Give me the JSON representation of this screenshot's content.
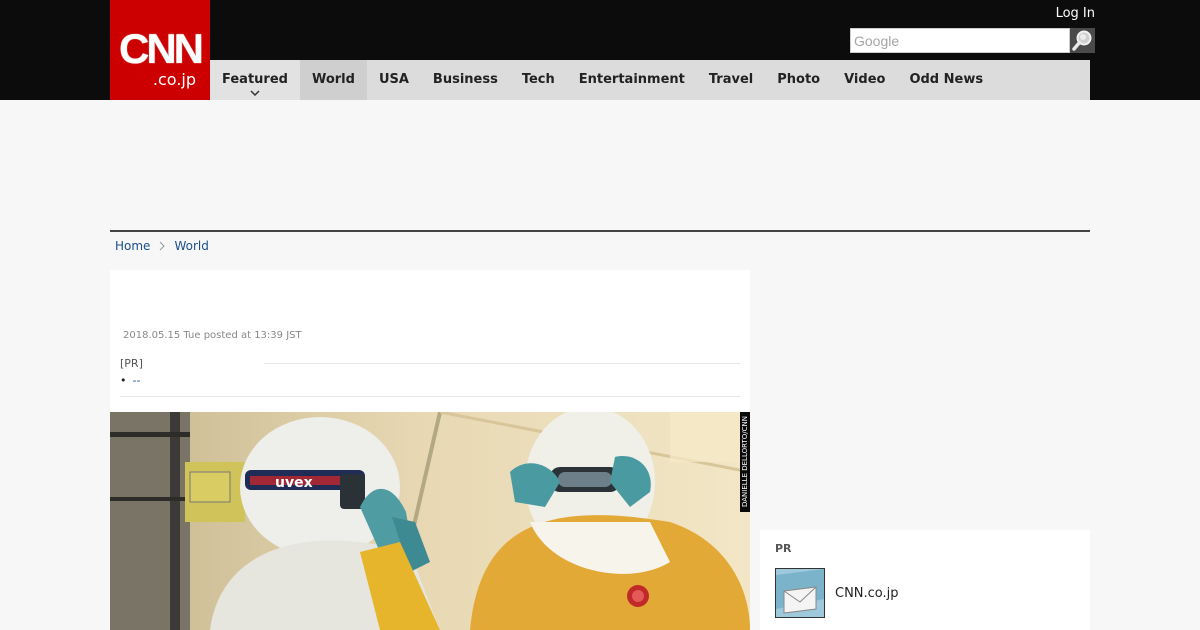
{
  "header": {
    "logo_main": "CNN",
    "logo_sub": ".co.jp",
    "login_label": "Log In",
    "search_placeholder": "Google",
    "search_icon": "magnifier-icon"
  },
  "nav": {
    "items": [
      {
        "label": "Featured"
      },
      {
        "label": "World"
      },
      {
        "label": "USA"
      },
      {
        "label": "Business"
      },
      {
        "label": "Tech"
      },
      {
        "label": "Entertainment"
      },
      {
        "label": "Travel"
      },
      {
        "label": "Photo"
      },
      {
        "label": "Video"
      },
      {
        "label": "Odd News"
      }
    ],
    "active_index": 1
  },
  "breadcrumb": {
    "home": "Home",
    "section": "World"
  },
  "article": {
    "datetime": "2018.05.15 Tue posted at 13:39 JST",
    "pr_label": "[PR]",
    "pr_bullet": "•",
    "pr_link": "--",
    "photo_credit": "DANIELLE DELLORTO/CNN",
    "goggle_brand": "uvex"
  },
  "sidebar": {
    "pr_heading": "PR",
    "pr_item_label": "CNN.co.jp"
  },
  "colors": {
    "brand_red": "#cc0000",
    "topbar_bg": "#0c0c0c",
    "nav_bg": "#dcdcdc",
    "link": "#1b4f8a"
  }
}
